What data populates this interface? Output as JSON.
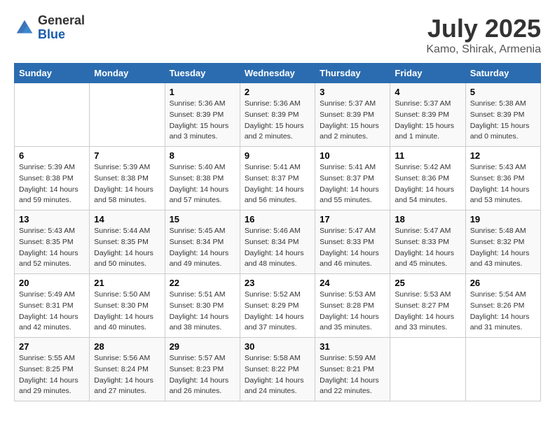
{
  "logo": {
    "general": "General",
    "blue": "Blue"
  },
  "title": "July 2025",
  "location": "Kamo, Shirak, Armenia",
  "weekdays": [
    "Sunday",
    "Monday",
    "Tuesday",
    "Wednesday",
    "Thursday",
    "Friday",
    "Saturday"
  ],
  "weeks": [
    [
      {
        "day": "",
        "sunrise": "",
        "sunset": "",
        "daylight": ""
      },
      {
        "day": "",
        "sunrise": "",
        "sunset": "",
        "daylight": ""
      },
      {
        "day": "1",
        "sunrise": "Sunrise: 5:36 AM",
        "sunset": "Sunset: 8:39 PM",
        "daylight": "Daylight: 15 hours and 3 minutes."
      },
      {
        "day": "2",
        "sunrise": "Sunrise: 5:36 AM",
        "sunset": "Sunset: 8:39 PM",
        "daylight": "Daylight: 15 hours and 2 minutes."
      },
      {
        "day": "3",
        "sunrise": "Sunrise: 5:37 AM",
        "sunset": "Sunset: 8:39 PM",
        "daylight": "Daylight: 15 hours and 2 minutes."
      },
      {
        "day": "4",
        "sunrise": "Sunrise: 5:37 AM",
        "sunset": "Sunset: 8:39 PM",
        "daylight": "Daylight: 15 hours and 1 minute."
      },
      {
        "day": "5",
        "sunrise": "Sunrise: 5:38 AM",
        "sunset": "Sunset: 8:39 PM",
        "daylight": "Daylight: 15 hours and 0 minutes."
      }
    ],
    [
      {
        "day": "6",
        "sunrise": "Sunrise: 5:39 AM",
        "sunset": "Sunset: 8:38 PM",
        "daylight": "Daylight: 14 hours and 59 minutes."
      },
      {
        "day": "7",
        "sunrise": "Sunrise: 5:39 AM",
        "sunset": "Sunset: 8:38 PM",
        "daylight": "Daylight: 14 hours and 58 minutes."
      },
      {
        "day": "8",
        "sunrise": "Sunrise: 5:40 AM",
        "sunset": "Sunset: 8:38 PM",
        "daylight": "Daylight: 14 hours and 57 minutes."
      },
      {
        "day": "9",
        "sunrise": "Sunrise: 5:41 AM",
        "sunset": "Sunset: 8:37 PM",
        "daylight": "Daylight: 14 hours and 56 minutes."
      },
      {
        "day": "10",
        "sunrise": "Sunrise: 5:41 AM",
        "sunset": "Sunset: 8:37 PM",
        "daylight": "Daylight: 14 hours and 55 minutes."
      },
      {
        "day": "11",
        "sunrise": "Sunrise: 5:42 AM",
        "sunset": "Sunset: 8:36 PM",
        "daylight": "Daylight: 14 hours and 54 minutes."
      },
      {
        "day": "12",
        "sunrise": "Sunrise: 5:43 AM",
        "sunset": "Sunset: 8:36 PM",
        "daylight": "Daylight: 14 hours and 53 minutes."
      }
    ],
    [
      {
        "day": "13",
        "sunrise": "Sunrise: 5:43 AM",
        "sunset": "Sunset: 8:35 PM",
        "daylight": "Daylight: 14 hours and 52 minutes."
      },
      {
        "day": "14",
        "sunrise": "Sunrise: 5:44 AM",
        "sunset": "Sunset: 8:35 PM",
        "daylight": "Daylight: 14 hours and 50 minutes."
      },
      {
        "day": "15",
        "sunrise": "Sunrise: 5:45 AM",
        "sunset": "Sunset: 8:34 PM",
        "daylight": "Daylight: 14 hours and 49 minutes."
      },
      {
        "day": "16",
        "sunrise": "Sunrise: 5:46 AM",
        "sunset": "Sunset: 8:34 PM",
        "daylight": "Daylight: 14 hours and 48 minutes."
      },
      {
        "day": "17",
        "sunrise": "Sunrise: 5:47 AM",
        "sunset": "Sunset: 8:33 PM",
        "daylight": "Daylight: 14 hours and 46 minutes."
      },
      {
        "day": "18",
        "sunrise": "Sunrise: 5:47 AM",
        "sunset": "Sunset: 8:33 PM",
        "daylight": "Daylight: 14 hours and 45 minutes."
      },
      {
        "day": "19",
        "sunrise": "Sunrise: 5:48 AM",
        "sunset": "Sunset: 8:32 PM",
        "daylight": "Daylight: 14 hours and 43 minutes."
      }
    ],
    [
      {
        "day": "20",
        "sunrise": "Sunrise: 5:49 AM",
        "sunset": "Sunset: 8:31 PM",
        "daylight": "Daylight: 14 hours and 42 minutes."
      },
      {
        "day": "21",
        "sunrise": "Sunrise: 5:50 AM",
        "sunset": "Sunset: 8:30 PM",
        "daylight": "Daylight: 14 hours and 40 minutes."
      },
      {
        "day": "22",
        "sunrise": "Sunrise: 5:51 AM",
        "sunset": "Sunset: 8:30 PM",
        "daylight": "Daylight: 14 hours and 38 minutes."
      },
      {
        "day": "23",
        "sunrise": "Sunrise: 5:52 AM",
        "sunset": "Sunset: 8:29 PM",
        "daylight": "Daylight: 14 hours and 37 minutes."
      },
      {
        "day": "24",
        "sunrise": "Sunrise: 5:53 AM",
        "sunset": "Sunset: 8:28 PM",
        "daylight": "Daylight: 14 hours and 35 minutes."
      },
      {
        "day": "25",
        "sunrise": "Sunrise: 5:53 AM",
        "sunset": "Sunset: 8:27 PM",
        "daylight": "Daylight: 14 hours and 33 minutes."
      },
      {
        "day": "26",
        "sunrise": "Sunrise: 5:54 AM",
        "sunset": "Sunset: 8:26 PM",
        "daylight": "Daylight: 14 hours and 31 minutes."
      }
    ],
    [
      {
        "day": "27",
        "sunrise": "Sunrise: 5:55 AM",
        "sunset": "Sunset: 8:25 PM",
        "daylight": "Daylight: 14 hours and 29 minutes."
      },
      {
        "day": "28",
        "sunrise": "Sunrise: 5:56 AM",
        "sunset": "Sunset: 8:24 PM",
        "daylight": "Daylight: 14 hours and 27 minutes."
      },
      {
        "day": "29",
        "sunrise": "Sunrise: 5:57 AM",
        "sunset": "Sunset: 8:23 PM",
        "daylight": "Daylight: 14 hours and 26 minutes."
      },
      {
        "day": "30",
        "sunrise": "Sunrise: 5:58 AM",
        "sunset": "Sunset: 8:22 PM",
        "daylight": "Daylight: 14 hours and 24 minutes."
      },
      {
        "day": "31",
        "sunrise": "Sunrise: 5:59 AM",
        "sunset": "Sunset: 8:21 PM",
        "daylight": "Daylight: 14 hours and 22 minutes."
      },
      {
        "day": "",
        "sunrise": "",
        "sunset": "",
        "daylight": ""
      },
      {
        "day": "",
        "sunrise": "",
        "sunset": "",
        "daylight": ""
      }
    ]
  ]
}
